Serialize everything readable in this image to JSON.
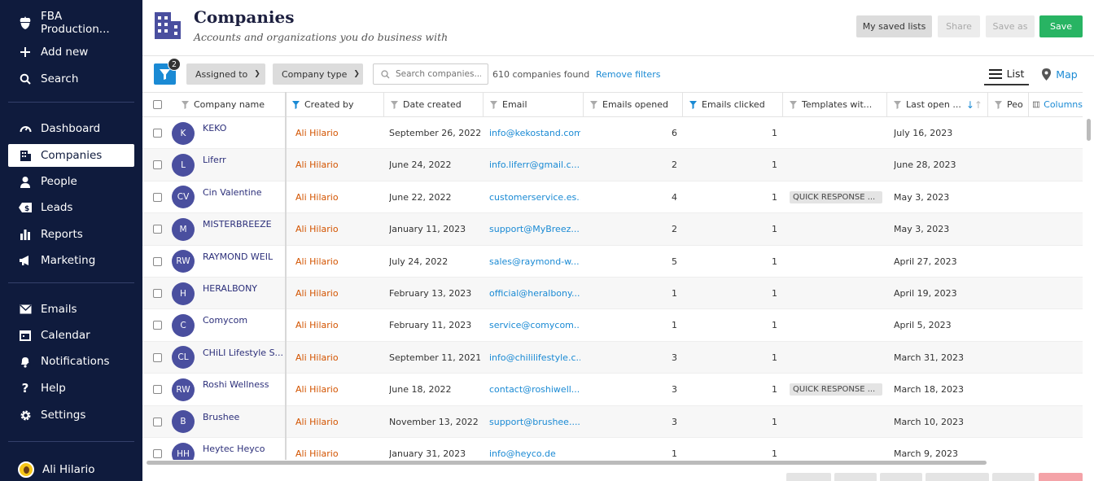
{
  "sidebar": {
    "org_name": "FBA Production...",
    "add_new": "Add new",
    "search": "Search",
    "nav": [
      {
        "label": "Dashboard",
        "icon": "dashboard-icon"
      },
      {
        "label": "Companies",
        "icon": "building-icon",
        "active": true
      },
      {
        "label": "People",
        "icon": "person-icon"
      },
      {
        "label": "Leads",
        "icon": "dollar-tag-icon"
      },
      {
        "label": "Reports",
        "icon": "bar-chart-icon"
      },
      {
        "label": "Marketing",
        "icon": "megaphone-icon"
      }
    ],
    "tools": [
      {
        "label": "Emails",
        "icon": "envelope-icon"
      },
      {
        "label": "Calendar",
        "icon": "calendar-icon"
      },
      {
        "label": "Notifications",
        "icon": "bell-icon"
      },
      {
        "label": "Help",
        "icon": "question-icon"
      },
      {
        "label": "Settings",
        "icon": "gear-icon"
      }
    ],
    "user_name": "Ali Hilario"
  },
  "header": {
    "title": "Companies",
    "subtitle": "Accounts and organizations you do business with",
    "btn_saved_lists": "My saved lists",
    "btn_share": "Share",
    "btn_save_as": "Save as",
    "btn_save": "Save"
  },
  "toolbar": {
    "filter_count": "2",
    "assigned_to": "Assigned to",
    "company_type": "Company type",
    "search_placeholder": "Search companies...",
    "found": "610 companies found",
    "remove_filters": "Remove filters",
    "view_list": "List",
    "view_map": "Map"
  },
  "table": {
    "columns": {
      "company_name": "Company name",
      "created_by": "Created by",
      "date_created": "Date created",
      "email": "Email",
      "emails_opened": "Emails opened",
      "emails_clicked": "Emails clicked",
      "templates": "Templates wit...",
      "last_open": "Last open ...",
      "people": "Peo",
      "columns_btn": "Columns"
    },
    "rows": [
      {
        "initials": "K",
        "name": "KEKO",
        "created_by": "Ali Hilario",
        "date": "September 26, 2022",
        "email": "info@kekostand.com",
        "opened": "6",
        "clicked": "1",
        "template": "",
        "last_open": "July 16, 2023"
      },
      {
        "initials": "L",
        "name": "Liferr",
        "created_by": "Ali Hilario",
        "date": "June 24, 2022",
        "email": "info.liferr@gmail.c...",
        "opened": "2",
        "clicked": "1",
        "template": "",
        "last_open": "June 28, 2023"
      },
      {
        "initials": "CV",
        "name": "Cin Valentine",
        "created_by": "Ali Hilario",
        "date": "June 22, 2022",
        "email": "customerservice.es...",
        "opened": "4",
        "clicked": "1",
        "template": "QUICK RESPONSE ...",
        "last_open": "May 3, 2023"
      },
      {
        "initials": "M",
        "name": "MISTERBREEZE",
        "created_by": "Ali Hilario",
        "date": "January 11, 2023",
        "email": "support@MyBreez...",
        "opened": "2",
        "clicked": "1",
        "template": "",
        "last_open": "May 3, 2023"
      },
      {
        "initials": "RW",
        "name": "RAYMOND WEIL",
        "created_by": "Ali Hilario",
        "date": "July 24, 2022",
        "email": "sales@raymond-w...",
        "opened": "5",
        "clicked": "1",
        "template": "",
        "last_open": "April 27, 2023"
      },
      {
        "initials": "H",
        "name": "HERALBONY",
        "created_by": "Ali Hilario",
        "date": "February 13, 2023",
        "email": "official@heralbony....",
        "opened": "1",
        "clicked": "1",
        "template": "",
        "last_open": "April 19, 2023"
      },
      {
        "initials": "C",
        "name": "Comycom",
        "created_by": "Ali Hilario",
        "date": "February 11, 2023",
        "email": "service@comycom....",
        "opened": "1",
        "clicked": "1",
        "template": "",
        "last_open": "April 5, 2023"
      },
      {
        "initials": "CL",
        "name": "CHiLI Lifestyle S...",
        "created_by": "Ali Hilario",
        "date": "September 11, 2021",
        "email": "info@chililifestyle.c...",
        "opened": "3",
        "clicked": "1",
        "template": "",
        "last_open": "March 31, 2023"
      },
      {
        "initials": "RW",
        "name": "Roshi Wellness",
        "created_by": "Ali Hilario",
        "date": "June 18, 2022",
        "email": "contact@roshiwell...",
        "opened": "3",
        "clicked": "1",
        "template": "QUICK RESPONSE ...",
        "last_open": "March 18, 2023"
      },
      {
        "initials": "B",
        "name": "Brushee",
        "created_by": "Ali Hilario",
        "date": "November 13, 2022",
        "email": "support@brushee....",
        "opened": "3",
        "clicked": "1",
        "template": "",
        "last_open": "March 10, 2023"
      },
      {
        "initials": "HH",
        "name": "Heytec Heyco",
        "created_by": "Ali Hilario",
        "date": "January 31, 2023",
        "email": "info@heyco.de",
        "opened": "1",
        "clicked": "1",
        "template": "",
        "last_open": "March 9, 2023"
      }
    ]
  },
  "colors": {
    "sidebar_bg": "#0f1b3d",
    "accent_blue": "#1a8ad4",
    "save_green": "#28b463",
    "creator_orange": "#d35400",
    "avatar_purple": "#4a4f9f"
  }
}
